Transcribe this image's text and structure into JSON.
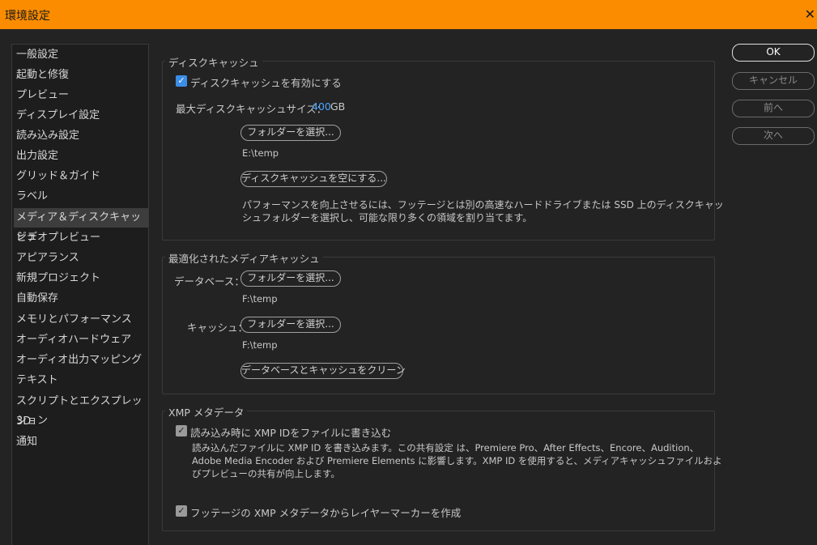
{
  "window": {
    "title": "環境設定",
    "close_glyph": "✕"
  },
  "sidebar": {
    "items": [
      {
        "label": "一般設定"
      },
      {
        "label": "起動と修復"
      },
      {
        "label": "プレビュー"
      },
      {
        "label": "ディスプレイ設定"
      },
      {
        "label": "読み込み設定"
      },
      {
        "label": "出力設定"
      },
      {
        "label": "グリッド＆ガイド"
      },
      {
        "label": "ラベル"
      },
      {
        "label": "メディア＆ディスクキャッシュ"
      },
      {
        "label": "ビデオプレビュー"
      },
      {
        "label": "アピアランス"
      },
      {
        "label": "新規プロジェクト"
      },
      {
        "label": "自動保存"
      },
      {
        "label": "メモリとパフォーマンス"
      },
      {
        "label": "オーディオハードウェア"
      },
      {
        "label": "オーディオ出力マッピング"
      },
      {
        "label": "テキスト"
      },
      {
        "label": "スクリプトとエクスプレッション"
      },
      {
        "label": "3D"
      },
      {
        "label": "通知"
      }
    ]
  },
  "disk_cache": {
    "title": "ディスクキャッシュ",
    "enable_label": "ディスクキャッシュを有効にする",
    "enable_checked": true,
    "max_size_label": "最大ディスクキャッシュサイズ：",
    "max_size_value": "400",
    "max_size_unit": "GB",
    "select_folder_button": "フォルダーを選択...",
    "folder_path": "E:\\temp",
    "empty_cache_button": "ディスクキャッシュを空にする...",
    "description_line1": "パフォーマンスを向上させるには、フッテージとは別の高速なハードドライブまたは SSD 上のディスクキャッ",
    "description_line2": "シュフォルダーを選択し、可能な限り多くの領域を割り当てます。"
  },
  "media_cache": {
    "title": "最適化されたメディアキャッシュ",
    "database_label": "データベース：",
    "database_button": "フォルダーを選択...",
    "database_path": "F:\\temp",
    "cache_label": "キャッシュ：",
    "cache_button": "フォルダーを選択...",
    "cache_path": "F:\\temp",
    "clean_button": "データベースとキャッシュをクリーン"
  },
  "xmp": {
    "title": "XMP メタデータ",
    "write_id_label": "読み込み時に XMP IDをファイルに書き込む",
    "write_id_checked": true,
    "write_id_desc_line1": "読み込んだファイルに XMP ID を書き込みます。この共有設定 は、Premiere Pro、After Effects、Encore、Audition、",
    "write_id_desc_line2": "Adobe Media Encoder および Premiere Elements に影響します。XMP ID を使用すると、メディアキャッシュファイルおよ",
    "write_id_desc_line3": "びプレビューの共有が向上します。",
    "layer_markers_label": "フッテージの XMP メタデータからレイヤーマーカーを作成",
    "layer_markers_checked": true
  },
  "buttons": {
    "ok": "OK",
    "cancel": "キャンセル",
    "prev": "前へ",
    "next": "次へ"
  },
  "colors": {
    "titlebar": "#fb8c00",
    "background": "#232323",
    "accent_value": "#4aa3ff",
    "checkbox_blue": "#3b8ee8"
  }
}
